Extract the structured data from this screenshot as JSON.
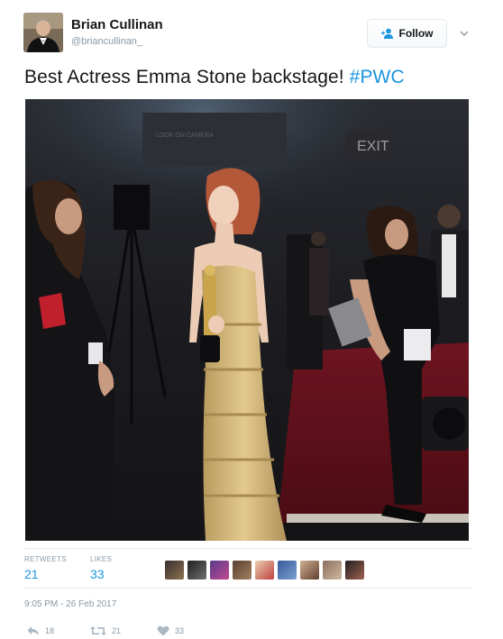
{
  "user": {
    "name": "Brian Cullinan",
    "handle": "@briancullinan_"
  },
  "follow_label": "Follow",
  "tweet": {
    "text": "Best Actress Emma Stone backstage! ",
    "hashtag": "#PWC"
  },
  "photo": {
    "sign_exit": "EXIT",
    "sign_camera": "LOOK ON CAMERA"
  },
  "stats": {
    "retweets_label": "RETWEETS",
    "retweets_value": "21",
    "likes_label": "LIKES",
    "likes_value": "33"
  },
  "likers": [
    "avatar-1",
    "avatar-2",
    "avatar-3",
    "avatar-4",
    "avatar-5",
    "avatar-6",
    "avatar-7",
    "avatar-8",
    "avatar-9"
  ],
  "timestamp": "9:05 PM - 26 Feb 2017",
  "actions": {
    "reply_count": "18",
    "retweet_count": "21",
    "like_count": "33"
  },
  "colors": {
    "link": "#1b95e0",
    "muted": "#8899a6",
    "border": "#e1e8ed"
  }
}
